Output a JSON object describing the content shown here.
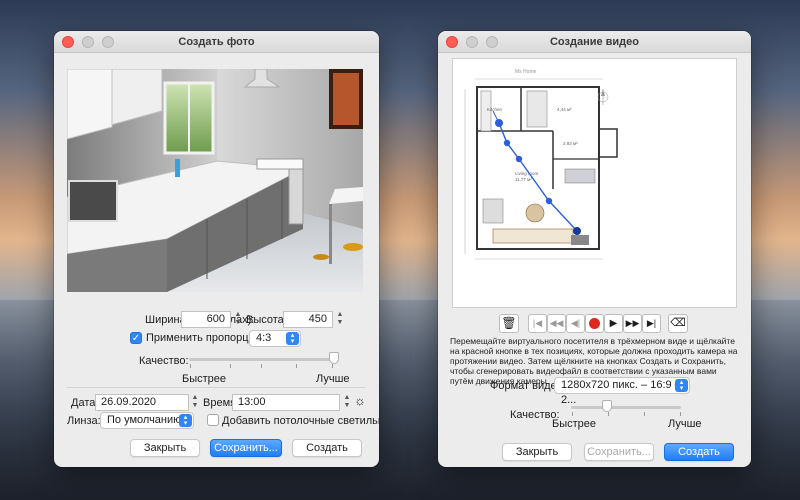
{
  "photo_window": {
    "title": "Создать фото",
    "width_label": "Ширина (в пикселах):",
    "width_value": "600",
    "height_label": "Высота:",
    "height_value": "450",
    "proportions_label": "Применить пропорции:",
    "proportions_checked": true,
    "ratio_value": "4:3",
    "quality_label": "Качество:",
    "quality_faster": "Быстрее",
    "quality_better": "Лучше",
    "quality_level": 1.0,
    "date_label": "Дата:",
    "date_value": "26.09.2020",
    "time_label": "Время:",
    "time_value": "13:00",
    "lens_label": "Линза:",
    "lens_value": "По умолчанию",
    "ceiling_lights_label": "Добавить потолочные светильники",
    "ceiling_lights_checked": false,
    "close_label": "Закрыть",
    "save_label": "Сохранить...",
    "create_label": "Создать"
  },
  "video_window": {
    "title": "Создание видео",
    "plan_title": "Ms Home",
    "room_labels": [
      "Kitchen",
      "4,44 м²",
      "2,93 м²",
      "Living room",
      "11,77 м²"
    ],
    "info_text": "Перемещайте виртуального посетителя в трёхмерном виде и щёлкайте на красной кнопке в тех позициях, которые должна проходить камера на протяжении видео. Затем щёлкните на кнопках Создать и Сохранить, чтобы сгенерировать видеофайл в соответствии с указанным вами путём движения камеры.",
    "format_label": "Формат видео:",
    "format_value": "1280x720 пикс. – 16:9 – 2...",
    "quality_label": "Качество:",
    "quality_faster": "Быстрее",
    "quality_better": "Лучше",
    "quality_level": 0.33,
    "close_label": "Закрыть",
    "save_label": "Сохранить...",
    "create_label": "Создать"
  },
  "colors": {
    "accent": "#2f86f6",
    "record": "#e0271f",
    "path": "#2f5fd8"
  }
}
